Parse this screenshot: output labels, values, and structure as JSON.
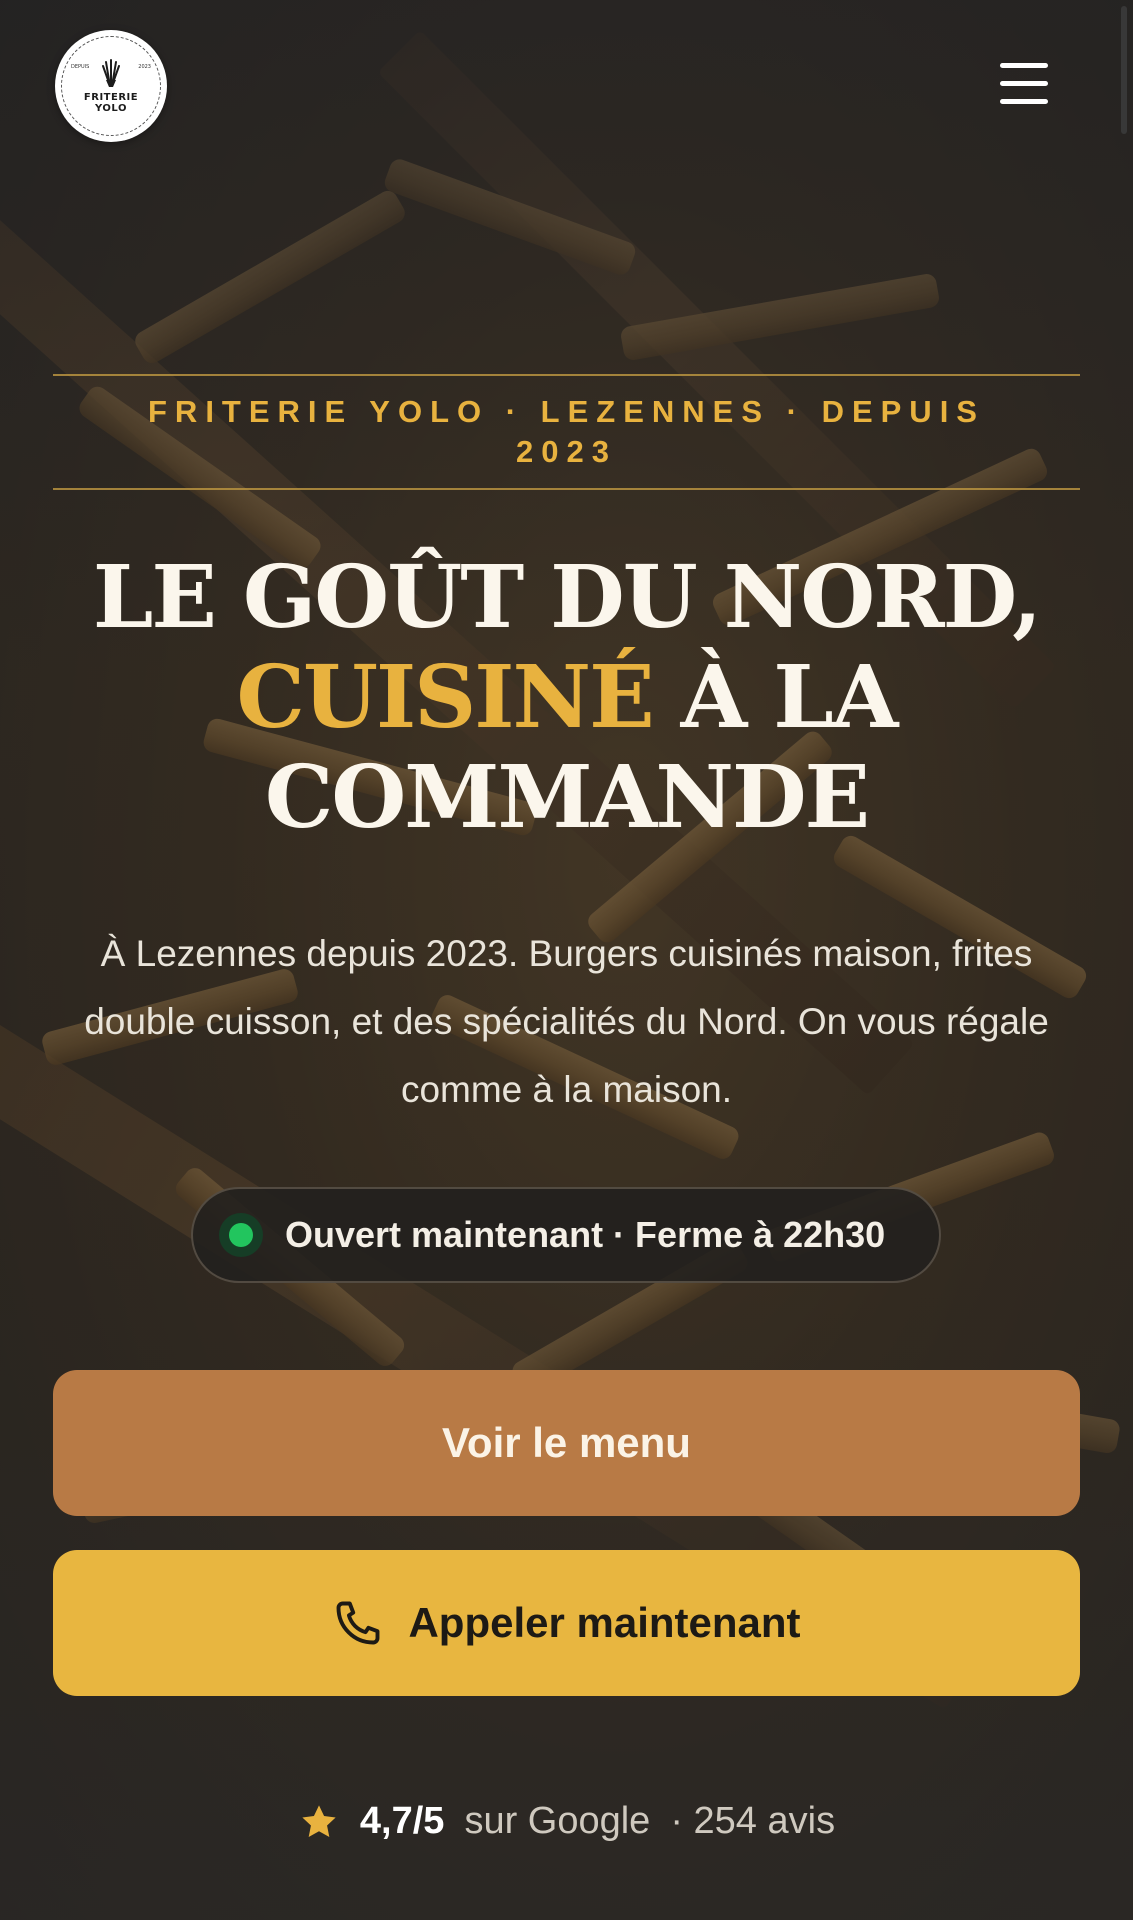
{
  "brand": {
    "logo_name": "FRITERIE\nYOLO",
    "logo_depuis_left": "DEPUIS",
    "logo_depuis_right": "2023"
  },
  "hero": {
    "eyebrow": "FRITERIE YOLO · LEZENNES · DEPUIS 2023",
    "headline_line1": "LE GOÛT DU NORD,",
    "headline_accent": "CUISINÉ",
    "headline_rest": " À LA COMMANDE",
    "lede": "À Lezennes depuis 2023. Burgers cuisinés maison, frites double cuisson, et des spécialités du Nord. On vous régale comme à la maison.",
    "status": "Ouvert maintenant · Ferme à 22h30"
  },
  "actions": {
    "menu_label": "Voir le menu",
    "call_label": "Appeler maintenant"
  },
  "rating": {
    "score": "4,7/5",
    "source": "sur Google",
    "reviews": "· 254 avis"
  },
  "colors": {
    "accent": "#e8b23f",
    "menu_button": "#b87a45",
    "call_button": "#e8b640",
    "status_open": "#22c55e"
  },
  "icons": [
    "menu-icon",
    "phone-icon",
    "star-icon",
    "fries-icon"
  ]
}
